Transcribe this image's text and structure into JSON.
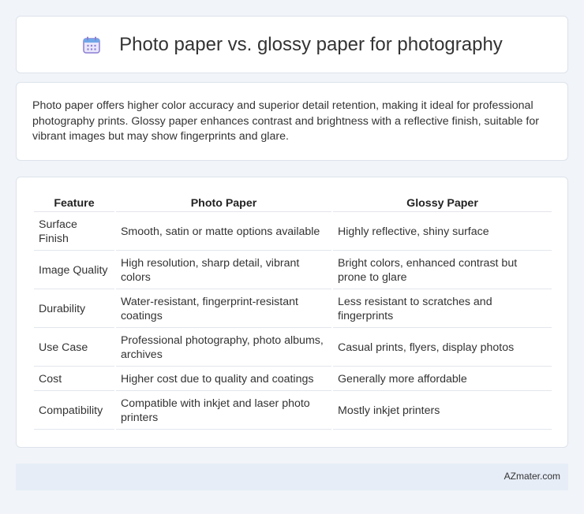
{
  "header": {
    "icon": "calendar-icon",
    "title": "Photo paper vs. glossy paper for photography"
  },
  "intro": {
    "text": "Photo paper offers higher color accuracy and superior detail retention, making it ideal for professional photography prints. Glossy paper enhances contrast and brightness with a reflective finish, suitable for vibrant images but may show fingerprints and glare."
  },
  "table": {
    "headers": [
      "Feature",
      "Photo Paper",
      "Glossy Paper"
    ],
    "rows": [
      [
        "Surface Finish",
        "Smooth, satin or matte options available",
        "Highly reflective, shiny surface"
      ],
      [
        "Image Quality",
        "High resolution, sharp detail, vibrant colors",
        "Bright colors, enhanced contrast but prone to glare"
      ],
      [
        "Durability",
        "Water-resistant, fingerprint-resistant coatings",
        "Less resistant to scratches and fingerprints"
      ],
      [
        "Use Case",
        "Professional photography, photo albums, archives",
        "Casual prints, flyers, display photos"
      ],
      [
        "Cost",
        "Higher cost due to quality and coatings",
        "Generally more affordable"
      ],
      [
        "Compatibility",
        "Compatible with inkjet and laser photo printers",
        "Mostly inkjet printers"
      ]
    ]
  },
  "footer": {
    "brand": "AZmater.com"
  },
  "colors": {
    "background": "#f1f4f9",
    "footer_bar": "#e6edf7",
    "icon_purple": "#8b7fd4",
    "icon_blue": "#6fa8e8"
  }
}
